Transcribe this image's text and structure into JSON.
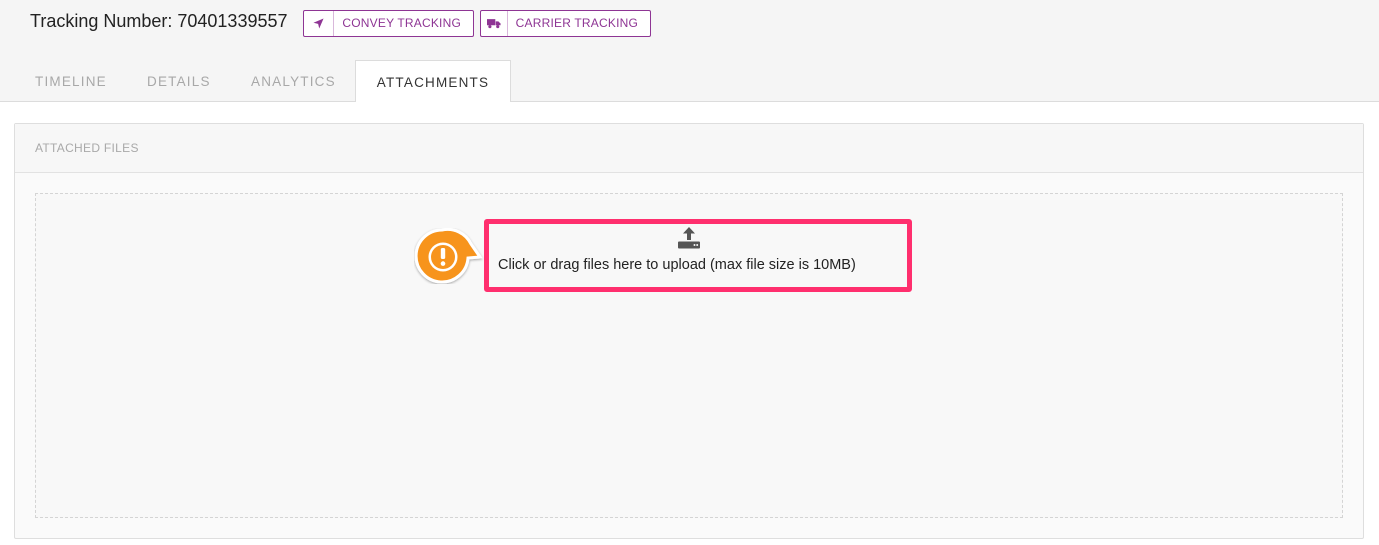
{
  "header": {
    "tracking_label": "Tracking Number: 70401339557",
    "buttons": {
      "convey": {
        "label": "CONVEY TRACKING",
        "icon": "location-arrow-icon"
      },
      "carrier": {
        "label": "CARRIER TRACKING",
        "icon": "truck-icon"
      }
    },
    "accent_color": "#8e3594"
  },
  "tabs": [
    {
      "label": "TIMELINE",
      "active": false
    },
    {
      "label": "DETAILS",
      "active": false
    },
    {
      "label": "ANALYTICS",
      "active": false
    },
    {
      "label": "ATTACHMENTS",
      "active": true
    }
  ],
  "attachments": {
    "panel_title": "ATTACHED FILES",
    "dropzone": {
      "icon": "upload-icon",
      "text": "Click or drag files here to upload (max file size is 10MB)"
    },
    "annotation": {
      "icon": "exclamation-icon",
      "highlight_color": "#ff2f6e",
      "callout_color": "#f7941d"
    }
  }
}
